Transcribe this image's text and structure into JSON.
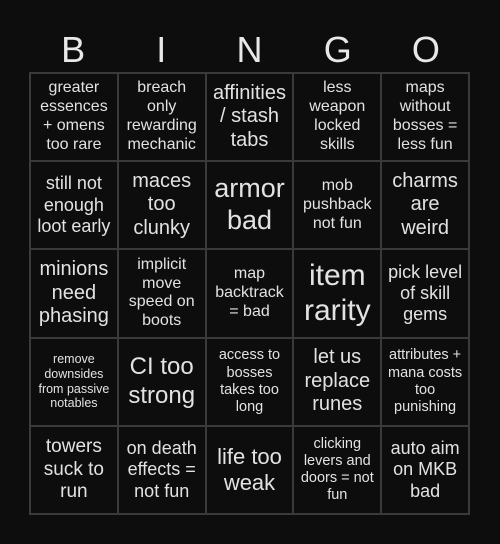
{
  "header": {
    "letters": [
      "B",
      "I",
      "N",
      "G",
      "O"
    ]
  },
  "cells": [
    [
      "greater essences + omens too rare",
      "breach only rewarding mechanic",
      "affinities / stash tabs",
      "less weapon locked skills",
      "maps without bosses = less fun"
    ],
    [
      "still not enough loot early",
      "maces too clunky",
      "armor bad",
      "mob pushback not fun",
      "charms are weird"
    ],
    [
      "minions need phasing",
      "implicit move speed on boots",
      "map backtrack = bad",
      "item rarity",
      "pick level of skill gems"
    ],
    [
      "remove downsides from passive notables",
      "CI too strong",
      "access to bosses takes too long",
      "let us replace runes",
      "attributes + mana costs too punishing"
    ],
    [
      "towers suck to run",
      "on death effects = not fun",
      "life too weak",
      "clicking levers and doors = not fun",
      "auto aim on MKB bad"
    ]
  ]
}
